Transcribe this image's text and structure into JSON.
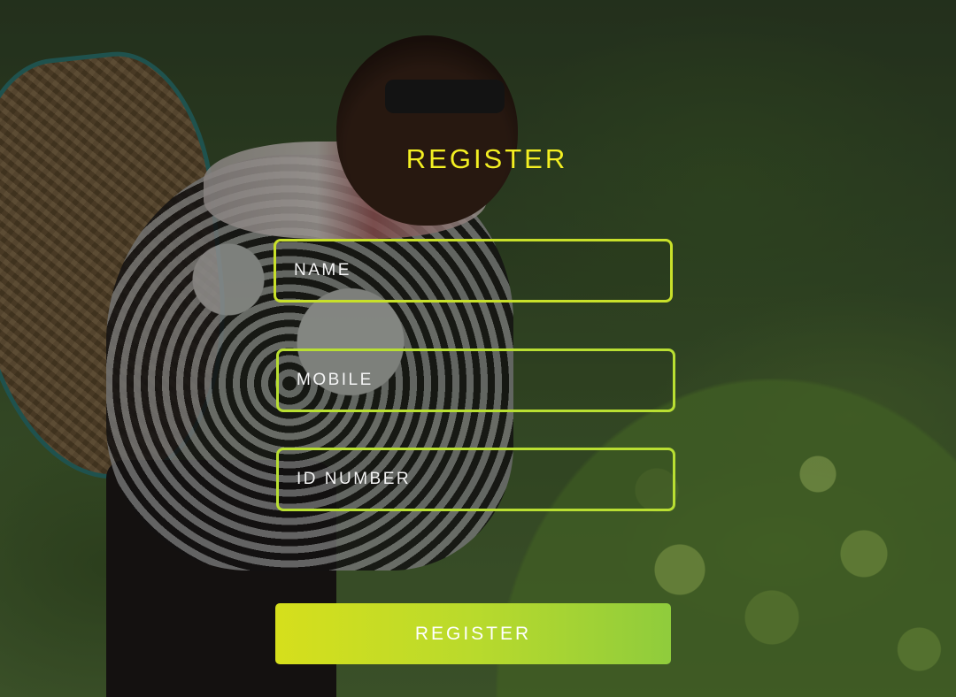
{
  "page": {
    "title": "REGISTER"
  },
  "form": {
    "name_placeholder": "NAME",
    "mobile_placeholder": "MOBILE",
    "id_placeholder": "ID NUMBER",
    "submit_label": "REGISTER"
  },
  "colors": {
    "title": "#f3ef22",
    "field_border": "#c8e02a",
    "button_gradient_start": "#d6df1c",
    "button_gradient_end": "#8fcc3c"
  },
  "background": {
    "image": "tea-farmer-photo"
  }
}
